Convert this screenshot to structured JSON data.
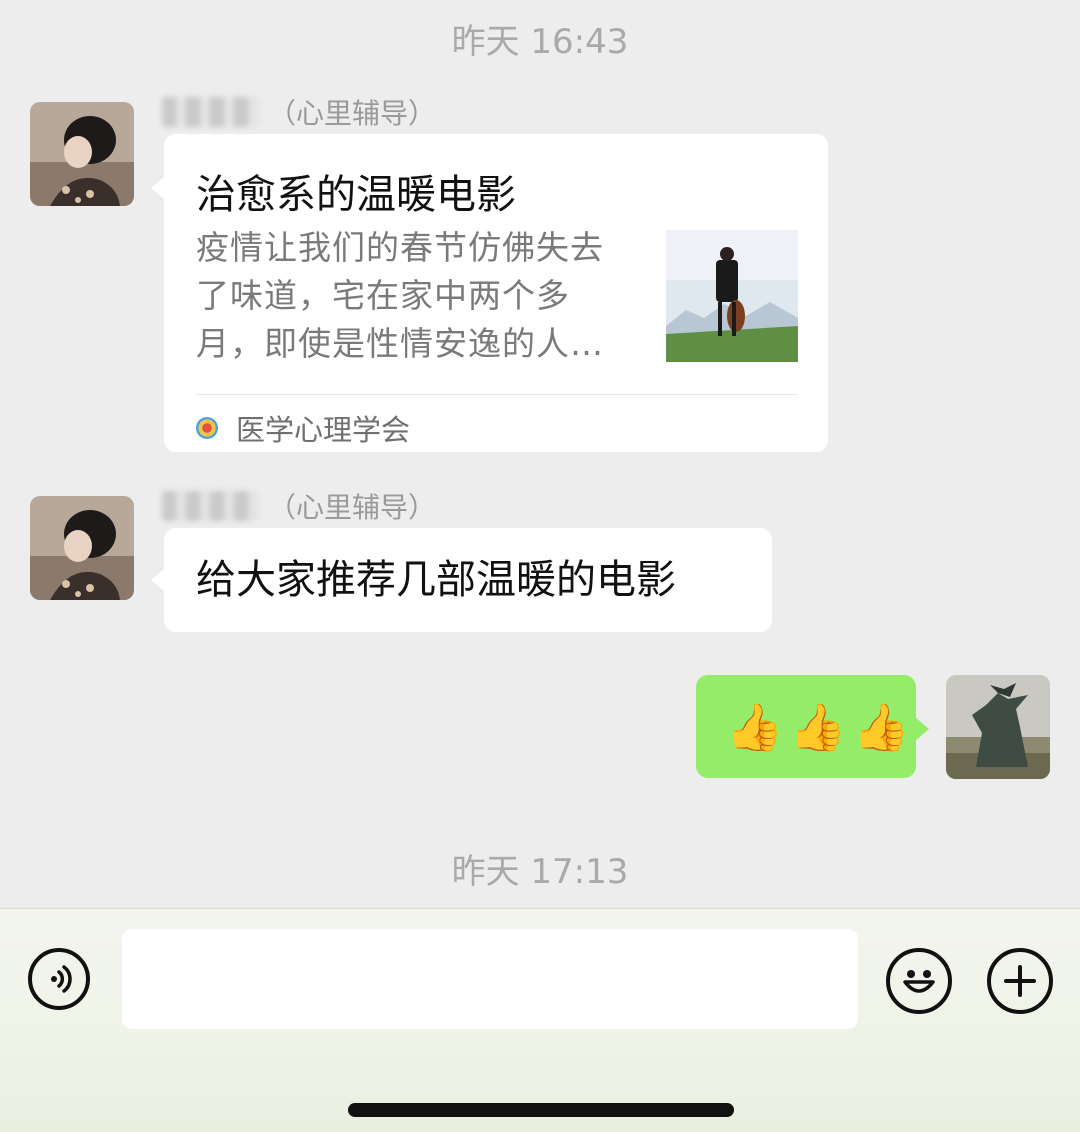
{
  "timestamps": [
    "昨天 16:43",
    "昨天 17:13"
  ],
  "messages": [
    {
      "sender_suffix": "（心里辅导）",
      "card": {
        "title": "治愈系的温暖电影",
        "description": "疫情让我们的春节仿佛失去了味道，宅在家中两个多月，即使是性情安逸的人…",
        "source": "医学心理学会"
      }
    },
    {
      "sender_suffix": "（心里辅导）",
      "text": "给大家推荐几部温暖的电影"
    },
    {
      "emoji": [
        "👍",
        "👍",
        "👍"
      ]
    }
  ],
  "input": {
    "value": ""
  },
  "colors": {
    "background": "#ededed",
    "bubble_self": "#95ec69",
    "bubble_other": "#ffffff",
    "timestamp": "#a9a9a9"
  },
  "icons": {
    "voice": "voice-icon",
    "emoji": "emoji-icon",
    "plus": "plus-icon"
  }
}
